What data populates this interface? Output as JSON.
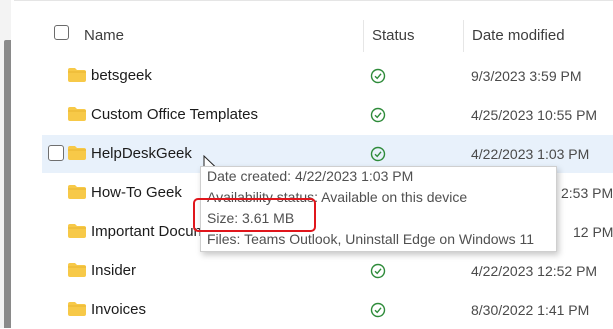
{
  "header": {
    "name_label": "Name",
    "status_label": "Status",
    "date_label": "Date modified"
  },
  "rows": [
    {
      "name": "betsgeek",
      "date": "9/3/2023 3:59 PM",
      "status": "check-circle-icon"
    },
    {
      "name": "Custom Office Templates",
      "date": "4/25/2023 10:55 PM",
      "status": "check-circle-icon"
    },
    {
      "name": "HelpDeskGeek",
      "date": "4/22/2023 1:03 PM",
      "status": "check-circle-icon"
    },
    {
      "name": "How-To Geek",
      "date": "2:53 PM",
      "status": "check-circle-icon"
    },
    {
      "name": "Important Docun",
      "date": "12 PM",
      "status": "check-circle-icon"
    },
    {
      "name": "Insider",
      "date": "4/22/2023 12:52 PM",
      "status": "check-circle-icon"
    },
    {
      "name": "Invoices",
      "date": "8/30/2022 1:41 PM",
      "status": "check-circle-icon"
    }
  ],
  "tooltip": {
    "date_created": "Date created: 4/22/2023 1:03 PM",
    "availability": "Availability status: Available on this device",
    "size": "Size: 3.61 MB",
    "files": "Files: Teams Outlook, Uninstall Edge on Windows 11"
  },
  "colors": {
    "folder": "#f7c948",
    "status_green": "#2e8b3a",
    "hover_row": "#e8f1fb",
    "highlight_red": "#e0161c"
  }
}
